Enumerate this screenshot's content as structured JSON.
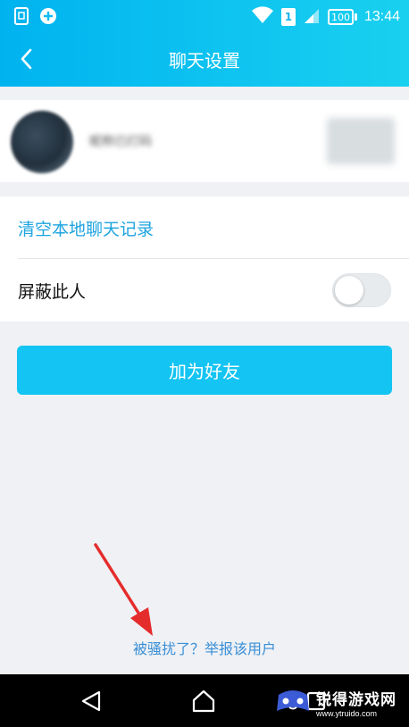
{
  "status_bar": {
    "battery": "100",
    "sim": "1",
    "time": "13:44",
    "icons": [
      "sim-card-icon",
      "add-circle-icon",
      "wifi-icon",
      "signal-icon",
      "battery-icon"
    ]
  },
  "header": {
    "title": "聊天设置",
    "back_icon": "chevron-left-icon"
  },
  "profile": {
    "name": "昵称已打码"
  },
  "settings": {
    "clear_history": "清空本地聊天记录",
    "block_user": "屏蔽此人",
    "block_enabled": false
  },
  "actions": {
    "add_friend": "加为好友"
  },
  "footer": {
    "report": "被骚扰了？举报该用户"
  },
  "watermark": {
    "title": "锐得游戏网",
    "url": "www.ytruido.com"
  },
  "colors": {
    "header_start": "#00b3ef",
    "header_end": "#1ad0ef",
    "accent": "#14c4f2",
    "link": "#1ea4e0",
    "annotation": "#e52c2c"
  }
}
